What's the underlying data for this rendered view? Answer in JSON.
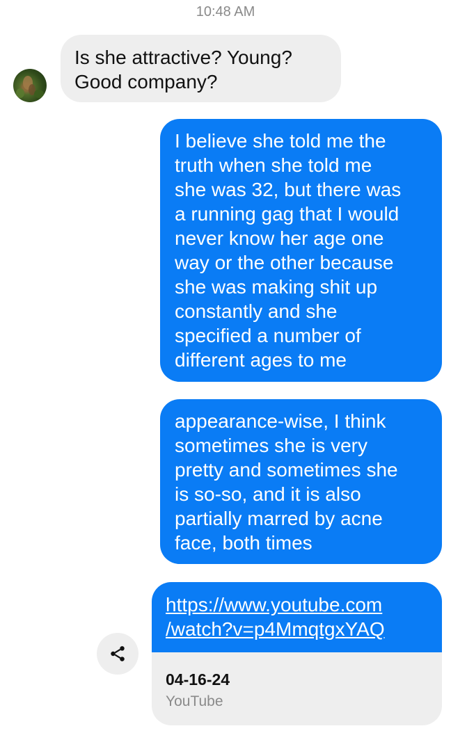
{
  "header": {
    "timestamp": "10:48 AM"
  },
  "messages": [
    {
      "direction": "incoming",
      "text": "Is she attractive? Young?\nGood company?"
    },
    {
      "direction": "outgoing",
      "text": "I believe she told me the\ntruth when she told me\nshe was 32, but there was\na running gag that I would\nnever know her age one\nway or the other because\nshe was making shit up\nconstantly and she\nspecified a number of\ndifferent ages to me"
    },
    {
      "direction": "outgoing",
      "text": "appearance-wise, I think\nsometimes she is very\npretty and sometimes she\nis so-so, and it is also\npartially marred by acne\nface, both times"
    }
  ],
  "link_message": {
    "url": "https://www.youtube.com\n/watch?v=p4MmqtgxYAQ",
    "preview_title": "04-16-24",
    "preview_source": "YouTube"
  },
  "icons": {
    "share": "share-icon",
    "avatar": "contact-avatar"
  },
  "colors": {
    "outgoing_bubble": "#0a7cf5",
    "incoming_bubble": "#eeeeee",
    "timestamp": "#8a8a8a"
  }
}
